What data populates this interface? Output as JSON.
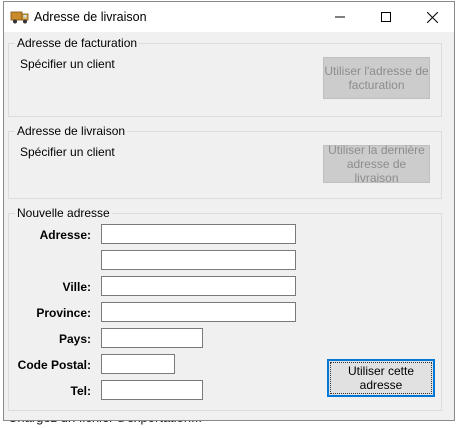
{
  "window": {
    "title": "Adresse de livraison"
  },
  "background": {
    "hint_text": "Chargez un fichier d'exportation..."
  },
  "billing": {
    "group_label": "Adresse de facturation",
    "client_text": "Spécifier un client",
    "use_button": "Utiliser l'adresse de facturation"
  },
  "shipping": {
    "group_label": "Adresse de livraison",
    "client_text": "Spécifier un client",
    "use_last_button": "Utiliser la dernière adresse de livraison"
  },
  "new_address": {
    "group_label": "Nouvelle adresse",
    "labels": {
      "address": "Adresse:",
      "city": "Ville:",
      "province": "Province:",
      "country": "Pays:",
      "postal": "Code Postal:",
      "phone": "Tel:"
    },
    "values": {
      "address1": "",
      "address2": "",
      "city": "",
      "province": "",
      "country": "",
      "postal": "",
      "phone": ""
    },
    "use_button": "Utiliser cette adresse"
  },
  "colors": {
    "focus_border": "#0078d7",
    "disabled_bg": "#cccccc",
    "window_bg": "#f0f0f0"
  }
}
